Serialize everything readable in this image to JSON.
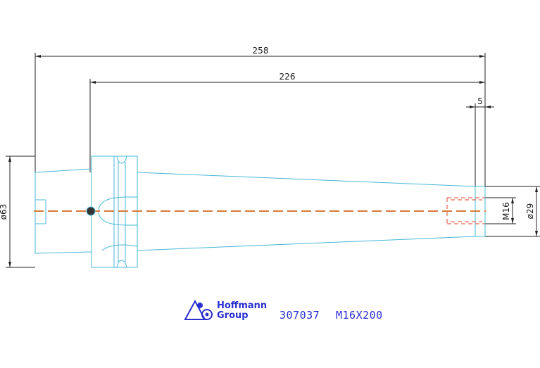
{
  "dimensions": {
    "overall_length": "258",
    "gauge_length": "226",
    "tip_length": "5",
    "flange_diameter": "ø63",
    "thread": "M16",
    "tip_diameter": "ø29"
  },
  "title_block": {
    "brand_line1": "Hoffmann",
    "brand_line2": "Group",
    "part_number": "307037",
    "designation": "M16X200"
  },
  "colors": {
    "dimension": "#222222",
    "body_outline": "#46b8d6",
    "thread": "#e0402a",
    "centerline": "#d87a3a",
    "brand": "#2a2fd0"
  },
  "icons": [
    "hoffmann-logo-icon"
  ]
}
